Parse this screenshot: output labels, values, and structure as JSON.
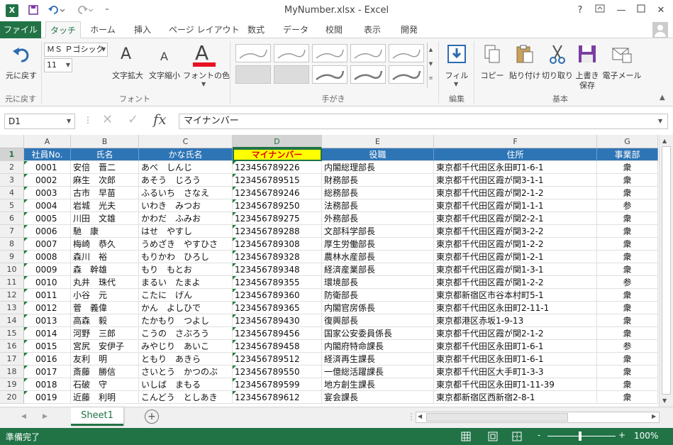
{
  "window": {
    "title": "MyNumber.xlsx - Excel",
    "help": "?",
    "app_icon": "X"
  },
  "tabs": [
    "ファイル",
    "タッチ",
    "ホーム",
    "挿入",
    "ページ レイアウト",
    "数式",
    "データ",
    "校閲",
    "表示",
    "開発"
  ],
  "ribbon": {
    "undo_label": "元に戻す",
    "undo_group": "元に戻す",
    "font_name": "ＭＳ Ｐゴシック",
    "font_size": "11",
    "grow_label": "文字拡大",
    "shrink_label": "文字縮小",
    "color_label": "フォントの色",
    "font_group": "フォント",
    "ink_group": "手がき",
    "filter_label": "フィル",
    "edit_group": "編集",
    "copy_label": "コピー",
    "paste_label": "貼り付け",
    "cut_label": "切り取り",
    "save_label": "上書き",
    "save_label2": "保存",
    "email_label": "電子メール",
    "basic_group": "基本",
    "font_color": "#e81123"
  },
  "formula_bar": {
    "name_box": "D1",
    "formula": "マイナンバー"
  },
  "columns": [
    "A",
    "B",
    "C",
    "D",
    "E",
    "F",
    "G"
  ],
  "selected_column": "D",
  "header_row": [
    "社員No.",
    "氏名",
    "かな氏名",
    "マイナンバー",
    "役職",
    "住所",
    "事業部"
  ],
  "rows": [
    [
      "0001",
      "安倍　晋二",
      "あべ　しんじ",
      "123456789226",
      "内閣総理部長",
      "東京都千代田区永田町1-6-1",
      "衆"
    ],
    [
      "0002",
      "麻生　次郎",
      "あそう　じろう",
      "123456789515",
      "財務部長",
      "東京都千代田区霞が関3-1-1",
      "衆"
    ],
    [
      "0003",
      "古市　早苗",
      "ふるいち　さなえ",
      "123456789246",
      "総務部長",
      "東京都千代田区霞が関2-1-2",
      "衆"
    ],
    [
      "0004",
      "岩城　光夫",
      "いわき　みつお",
      "123456789250",
      "法務部長",
      "東京都千代田区霞が関1-1-1",
      "参"
    ],
    [
      "0005",
      "川田　文雄",
      "かわだ　ふみお",
      "123456789275",
      "外務部長",
      "東京都千代田区霞が関2-2-1",
      "衆"
    ],
    [
      "0006",
      "馳　康",
      "はせ　やすし",
      "123456789288",
      "文部科学部長",
      "東京都千代田区霞が関3-2-2",
      "衆"
    ],
    [
      "0007",
      "梅崎　恭久",
      "うめざき　やすひさ",
      "123456789308",
      "厚生労働部長",
      "東京都千代田区霞が関1-2-2",
      "衆"
    ],
    [
      "0008",
      "森川　裕",
      "もりかわ　ひろし",
      "123456789328",
      "農林水産部長",
      "東京都千代田区霞が関1-2-1",
      "衆"
    ],
    [
      "0009",
      "森　幹雄",
      "もり　もとお",
      "123456789348",
      "経済産業部長",
      "東京都千代田区霞が関1-3-1",
      "衆"
    ],
    [
      "0010",
      "丸井　珠代",
      "まるい　たまよ",
      "123456789355",
      "環境部長",
      "東京都千代田区霞が関1-2-2",
      "参"
    ],
    [
      "0011",
      "小谷　元",
      "こたに　げん",
      "123456789360",
      "防衛部長",
      "東京都新宿区市谷本村町5-1",
      "衆"
    ],
    [
      "0012",
      "菅　義偉",
      "かん　よしひで",
      "123456789365",
      "内閣官房係長",
      "東京都千代田区永田町2-11-1",
      "衆"
    ],
    [
      "0013",
      "高森　毅",
      "たかもり　つよし",
      "123456789430",
      "復興部長",
      "東京都港区赤坂1-9-13",
      "衆"
    ],
    [
      "0014",
      "河野　三郎",
      "こうの　さぶろう",
      "123456789456",
      "国家公安委員係長",
      "東京都千代田区霞が関2-1-2",
      "衆"
    ],
    [
      "0015",
      "宮尻　安伊子",
      "みやじり　あいこ",
      "123456789458",
      "内閣府特命課長",
      "東京都千代田区永田町1-6-1",
      "参"
    ],
    [
      "0016",
      "友利　明",
      "ともり　あきら",
      "123456789512",
      "経済再生課長",
      "東京都千代田区永田町1-6-1",
      "衆"
    ],
    [
      "0017",
      "斎藤　勝信",
      "さいとう　かつのぶ",
      "123456789550",
      "一億総活躍課長",
      "東京都千代田区大手町1-3-3",
      "衆"
    ],
    [
      "0018",
      "石破　守",
      "いしば　まもる",
      "123456789599",
      "地方創生課長",
      "東京都千代田区永田町1-11-39",
      "衆"
    ],
    [
      "0019",
      "近藤　利明",
      "こんどう　としあき",
      "123456789612",
      "宴会課長",
      "東京都新宿区西新宿2-8-1",
      "衆"
    ]
  ],
  "sheet_tab": "Sheet1",
  "add_sheet": "+",
  "status": {
    "ready": "準備完了",
    "zoom": "100%",
    "minus": "-",
    "plus": "+"
  },
  "colors": {
    "accent": "#217346",
    "header_fill": "#2e75b6",
    "selected_fill": "#ffff00",
    "selected_text": "#e80000"
  }
}
